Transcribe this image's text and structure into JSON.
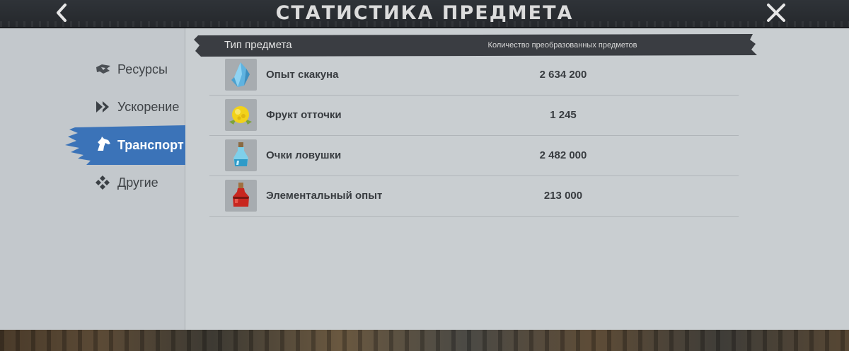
{
  "header": {
    "title": "СТАТИСТИКА ПРЕДМЕТА",
    "back_icon": "chevron-left-icon",
    "close_icon": "close-icon"
  },
  "sidebar": {
    "items": [
      {
        "label": "Ресурсы",
        "icon": "resources-icon",
        "active": false
      },
      {
        "label": "Ускорение",
        "icon": "speedup-icon",
        "active": false
      },
      {
        "label": "Транспорт",
        "icon": "horse-icon",
        "active": true
      },
      {
        "label": "Другие",
        "icon": "other-icon",
        "active": false
      }
    ]
  },
  "table": {
    "columns": {
      "type": "Тип предмета",
      "count": "Количество преобразованных предметов"
    },
    "rows": [
      {
        "name": "Опыт скакуна",
        "count": "2 634 200",
        "icon": "blue-crystal-icon"
      },
      {
        "name": "Фрукт отточки",
        "count": "1 245",
        "icon": "yellow-fruit-icon"
      },
      {
        "name": "Очки ловушки",
        "count": "2 482 000",
        "icon": "blue-potion-icon"
      },
      {
        "name": "Элементальный опыт",
        "count": "213 000",
        "icon": "red-potion-icon"
      }
    ]
  },
  "colors": {
    "accent": "#3b73b8",
    "header_bg": "#2a2d31",
    "panel_bg": "#c9ced1",
    "text_dark": "#383c40"
  }
}
